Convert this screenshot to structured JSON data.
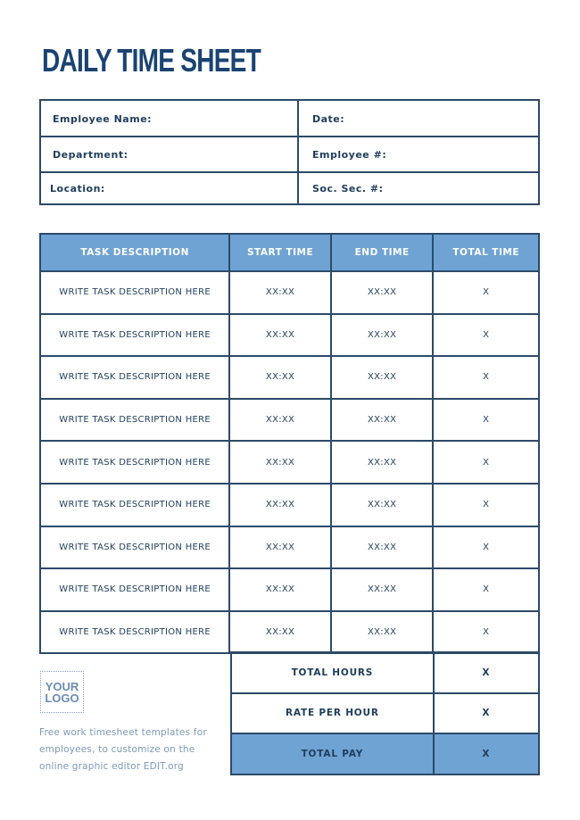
{
  "title": "DAILY TIME SHEET",
  "info_fields": {
    "employee_name": "Employee Name:",
    "date": "Date:",
    "department": "Department:",
    "employee_number": "Employee #:",
    "location": "Location:",
    "soc_sec": "Soc. Sec. #:"
  },
  "table": {
    "headers": [
      "TASK DESCRIPTION",
      "START TIME",
      "END TIME",
      "TOTAL TIME"
    ],
    "rows": [
      [
        "WRITE TASK DESCRIPTION HERE",
        "XX:XX",
        "XX:XX",
        "X"
      ],
      [
        "WRITE TASK DESCRIPTION HERE",
        "XX:XX",
        "XX:XX",
        "X"
      ],
      [
        "WRITE TASK DESCRIPTION HERE",
        "XX:XX",
        "XX:XX",
        "X"
      ],
      [
        "WRITE TASK DESCRIPTION HERE",
        "XX:XX",
        "XX:XX",
        "X"
      ],
      [
        "WRITE TASK DESCRIPTION HERE",
        "XX:XX",
        "XX:XX",
        "X"
      ],
      [
        "WRITE TASK DESCRIPTION HERE",
        "XX:XX",
        "XX:XX",
        "X"
      ],
      [
        "WRITE TASK DESCRIPTION HERE",
        "XX:XX",
        "XX:XX",
        "X"
      ],
      [
        "WRITE TASK DESCRIPTION HERE",
        "XX:XX",
        "XX:XX",
        "X"
      ],
      [
        "WRITE TASK DESCRIPTION HERE",
        "XX:XX",
        "XX:XX",
        "X"
      ]
    ]
  },
  "summary": [
    {
      "label": "TOTAL HOURS",
      "value": "X"
    },
    {
      "label": "RATE PER HOUR",
      "value": "X"
    },
    {
      "label": "TOTAL PAY",
      "value": "X"
    }
  ],
  "logo": {
    "line1": "YOUR",
    "line2": "LOGO"
  },
  "footnote": "Free work timesheet templates for employees, to customize on the online graphic editor EDIT.org",
  "colors": {
    "primary": "#1a4372",
    "header_fill": "#6fa3d3",
    "border": "#2c4a6a"
  }
}
